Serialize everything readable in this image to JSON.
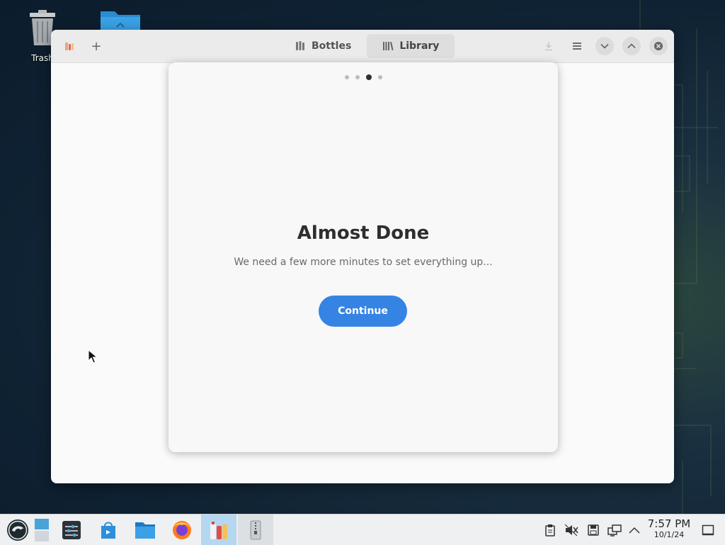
{
  "desktop": {
    "trash_label": "Trash",
    "icons": [
      "trash-icon",
      "folder-icon"
    ]
  },
  "window": {
    "header": {
      "app_icon": "bottles-app-icon",
      "add_icon": "+",
      "tabs": [
        {
          "label": "Bottles",
          "icon": "bottles-icon",
          "active": false
        },
        {
          "label": "Library",
          "icon": "library-icon",
          "active": true
        }
      ],
      "controls": [
        "download-icon",
        "hamburger-menu-icon",
        "minimize-icon",
        "maximize-icon",
        "close-icon"
      ]
    },
    "onboarding": {
      "pages_total": 4,
      "current_page": 3,
      "title": "Almost Done",
      "subtitle": "We need a few more minutes to set everything up...",
      "continue_label": "Continue",
      "accent": "#3584e4"
    }
  },
  "taskbar": {
    "apps": [
      "opensuse-start-icon",
      "show-desktop-icon",
      "settings-icon",
      "software-store-icon",
      "file-manager-icon",
      "firefox-icon",
      "bottles-icon",
      "archive-icon"
    ],
    "tray": [
      "clipboard-icon",
      "volume-muted-icon",
      "storage-icon",
      "network-icon",
      "tray-expand-icon"
    ],
    "clock": {
      "time": "7:57 PM",
      "date": "10/1/24"
    }
  }
}
